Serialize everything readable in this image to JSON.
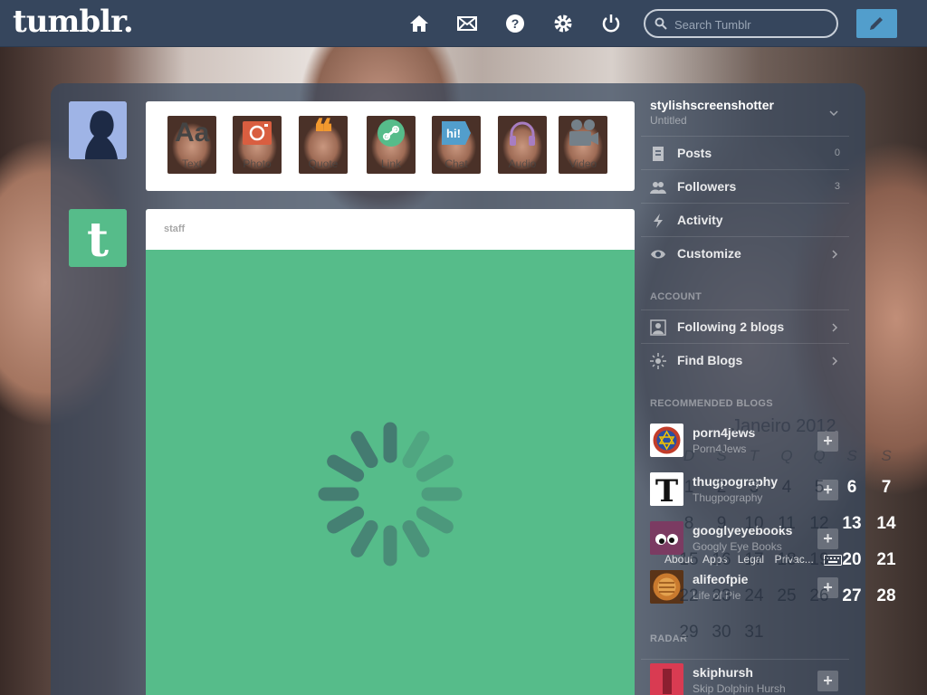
{
  "app": {
    "logo_text": "tumblr."
  },
  "header": {
    "nav_icons": [
      "home-icon",
      "mail-icon",
      "help-icon",
      "gear-icon",
      "power-icon"
    ],
    "search": {
      "placeholder": "Search Tumblr",
      "value": ""
    },
    "compose_icon": "pencil-icon"
  },
  "post_types": [
    {
      "label": "Text",
      "glyph": "Aa",
      "color": "#444444"
    },
    {
      "label": "Photo",
      "glyph": "",
      "color": "#d95e40"
    },
    {
      "label": "Quote",
      "glyph": "❝",
      "color": "#f2992e"
    },
    {
      "label": "Link",
      "glyph": "",
      "color": "#56bc8a"
    },
    {
      "label": "Chat",
      "glyph": "hi!",
      "color": "#529ecc"
    },
    {
      "label": "Audio",
      "glyph": "",
      "color": "#a77dc2"
    },
    {
      "label": "Video",
      "glyph": "",
      "color": "#748089"
    }
  ],
  "post": {
    "author": "staff",
    "state": "loading"
  },
  "sidebar": {
    "blog_name": "stylishscreenshotter",
    "blog_title": "Untitled",
    "items": [
      {
        "label": "Posts",
        "count": "0",
        "icon": "posts-icon"
      },
      {
        "label": "Followers",
        "count": "3",
        "icon": "followers-icon"
      },
      {
        "label": "Activity",
        "count": "",
        "icon": "activity-icon"
      },
      {
        "label": "Customize",
        "count": "",
        "icon": "eye-icon"
      }
    ],
    "account_heading": "ACCOUNT",
    "account_items": [
      {
        "label": "Following 2 blogs",
        "icon": "following-icon"
      },
      {
        "label": "Find Blogs",
        "icon": "find-blogs-icon"
      }
    ],
    "recommended_heading": "RECOMMENDED BLOGS",
    "recommended": [
      {
        "name": "porn4jews",
        "title": "Porn4Jews"
      },
      {
        "name": "thugpography",
        "title": "Thugpography"
      },
      {
        "name": "googlyeyebooks",
        "title": "Googly Eye Books"
      },
      {
        "name": "alifeofpie",
        "title": "Life of Pie"
      }
    ],
    "footer": [
      "About",
      "Apps",
      "Legal",
      "Privac..."
    ],
    "radar_heading": "RADAR",
    "radar": {
      "name": "skiphursh",
      "title": "Skip Dolphin Hursh"
    }
  },
  "calendar": {
    "title": "Janeiro 2012",
    "weekdays": [
      "D",
      "S",
      "T",
      "Q",
      "Q",
      "S",
      "S"
    ],
    "weeks": [
      [
        "1",
        "2",
        "3",
        "4",
        "5",
        "6",
        "7"
      ],
      [
        "8",
        "9",
        "10",
        "11",
        "12",
        "13",
        "14"
      ],
      [
        "15",
        "16",
        "17",
        "18",
        "19",
        "20",
        "21"
      ],
      [
        "22",
        "23",
        "24",
        "25",
        "26",
        "27",
        "28"
      ],
      [
        "29",
        "30",
        "31",
        "",
        "",
        "",
        ""
      ]
    ]
  },
  "colors": {
    "header": "#36465d",
    "compose": "#529ecc",
    "post_bg": "#56bc8a"
  }
}
